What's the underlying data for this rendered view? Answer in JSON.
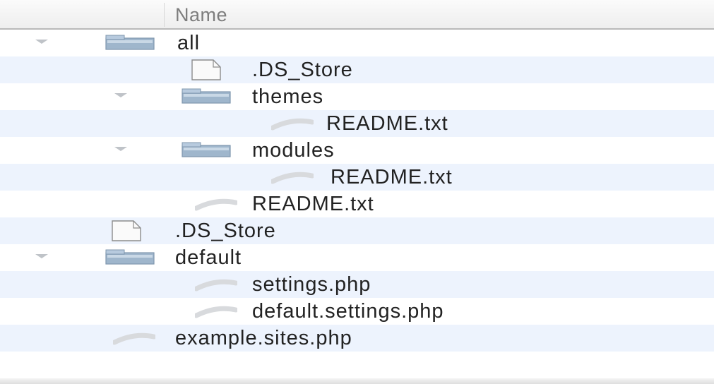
{
  "header": {
    "name_label": "Name"
  },
  "rows": [
    {
      "name": "all",
      "type": "folder",
      "depth": 0,
      "expanded": true
    },
    {
      "name": ".DS_Store",
      "type": "file",
      "depth": 1
    },
    {
      "name": "themes",
      "type": "folder",
      "depth": 1,
      "expanded": true
    },
    {
      "name": "README.txt",
      "type": "text-file",
      "depth": 2
    },
    {
      "name": "modules",
      "type": "folder",
      "depth": 1,
      "expanded": true
    },
    {
      "name": "README.txt",
      "type": "text-file",
      "depth": 2
    },
    {
      "name": "README.txt",
      "type": "text-file",
      "depth": 1
    },
    {
      "name": ".DS_Store",
      "type": "file",
      "depth": 0
    },
    {
      "name": "default",
      "type": "folder",
      "depth": 0,
      "expanded": true
    },
    {
      "name": "settings.php",
      "type": "text-file",
      "depth": 1
    },
    {
      "name": "default.settings.php",
      "type": "text-file",
      "depth": 1
    },
    {
      "name": "example.sites.php",
      "type": "text-file",
      "depth": 0
    }
  ],
  "colors": {
    "stripe": "#edf3fd",
    "folder": "#9fb6cc",
    "text": "#222222"
  }
}
